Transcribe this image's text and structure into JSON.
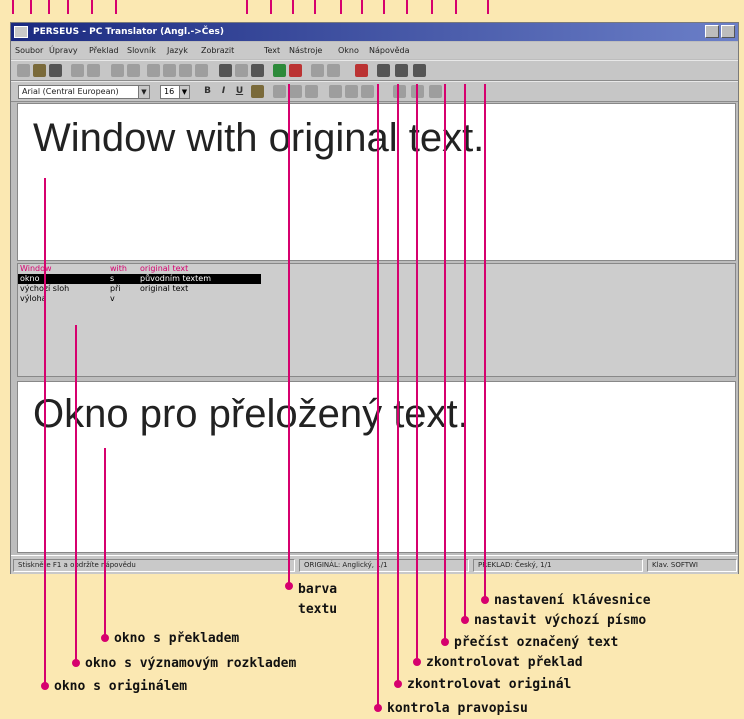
{
  "window": {
    "title": "PERSEUS - PC Translator (Angl.->Čes)",
    "menu": [
      "Soubor",
      "Úpravy",
      "Překlad",
      "Slovník",
      "Jazyk",
      "Zobrazit",
      "Text",
      "Nástroje",
      "Okno",
      "Nápověda"
    ],
    "font_name": "Arial (Central European)",
    "font_size": "16",
    "original_text": "Window with original text.",
    "translated_text": "Okno pro přeložený text.",
    "dictionary": {
      "header": [
        "Window",
        "with",
        "original text"
      ],
      "rows": [
        [
          "okno",
          "s",
          "původním textem"
        ],
        [
          "výchozí sloh",
          "při",
          "original text"
        ],
        [
          "výloha",
          "v",
          ""
        ]
      ]
    },
    "status": {
      "help": "Stiskněte F1 a obdržíte nápovědu",
      "original": "ORIGINÁL: Anglický, 1/1",
      "translation": "PŘEKLAD: Český, 1/1",
      "mode": "Klav. SOFTWI"
    }
  },
  "callouts": {
    "text_color": "barva textu",
    "keyboard_setup": "nastavení klávesnice",
    "default_font": "nastavit výchozí písmo",
    "read_selected": "přečíst označený text",
    "check_translation": "zkontrolovat překlad",
    "check_original": "zkontrolovat originál",
    "spell_check": "kontrola pravopisu",
    "translation_window": "okno s překladem",
    "meaning_window": "okno s významovým rozkladem",
    "original_window": "okno s originálem"
  },
  "colors": {
    "accent": "#d6006e",
    "background": "#fbe8b2"
  }
}
